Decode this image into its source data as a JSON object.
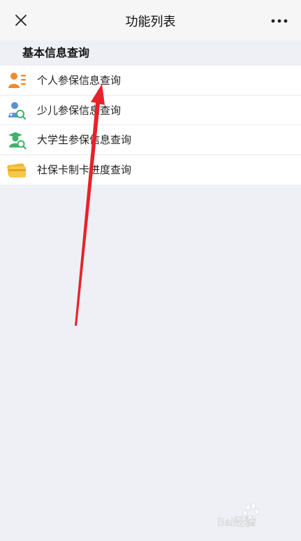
{
  "titlebar": {
    "title": "功能列表",
    "close_icon": "close-icon",
    "more_icon": "more-dots-icon"
  },
  "section": {
    "title": "基本信息查询"
  },
  "menu": {
    "items": [
      {
        "label": "个人参保信息查询",
        "icon": "person-card-icon",
        "color": "#f08a2c"
      },
      {
        "label": "少儿参保信息查询",
        "icon": "child-search-icon",
        "color": "#5b8fd6"
      },
      {
        "label": "大学生参保信息查询",
        "icon": "graduate-search-icon",
        "color": "#3fb36a"
      },
      {
        "label": "社保卡制卡进度查询",
        "icon": "card-icon",
        "color": "#f2b731"
      }
    ]
  },
  "annotation": {
    "type": "red-arrow",
    "color": "#e8222b",
    "points_to": "menu.items.0"
  },
  "watermark": {
    "icon": "baidu-logo-icon",
    "text": "Bai经验"
  },
  "colors": {
    "background": "#eef0f5",
    "titlebar": "#f6f6f6",
    "list_bg": "#ffffff"
  }
}
